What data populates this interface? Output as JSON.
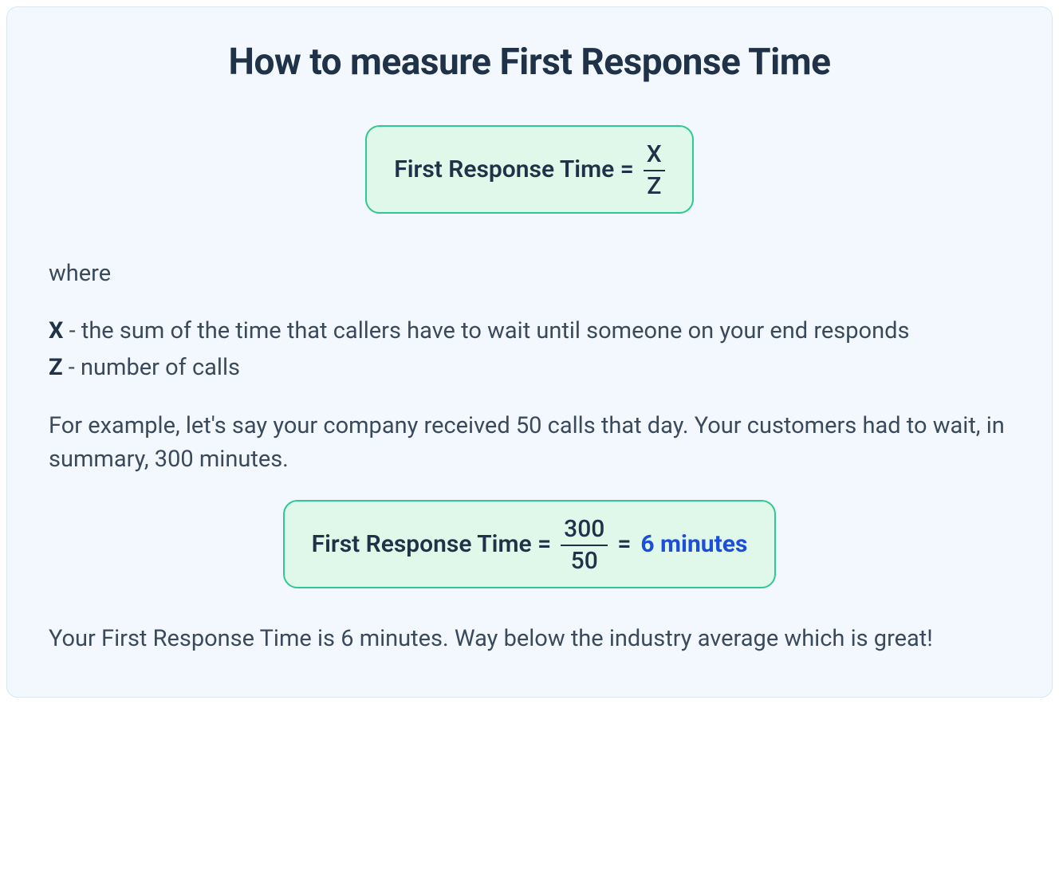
{
  "title": "How to measure First Response Time",
  "formula": {
    "label": "First Response Time =",
    "numerator": "X",
    "denominator": "Z"
  },
  "where_label": "where",
  "definitions": {
    "x": {
      "symbol": "X",
      "sep": " - ",
      "text": "the sum of the time that callers have to wait until someone on your end responds"
    },
    "z": {
      "symbol": "Z",
      "sep": " - ",
      "text": "number of calls"
    }
  },
  "example_text": "For example, let's say your company received 50 calls that day. Your customers had to wait, in summary, 300 minutes.",
  "example_formula": {
    "label": "First Response Time =",
    "numerator": "300",
    "denominator": "50",
    "equals": "=",
    "result": "6 minutes"
  },
  "conclusion": "Your First Response Time is 6 minutes. Way below the industry average which is great!"
}
